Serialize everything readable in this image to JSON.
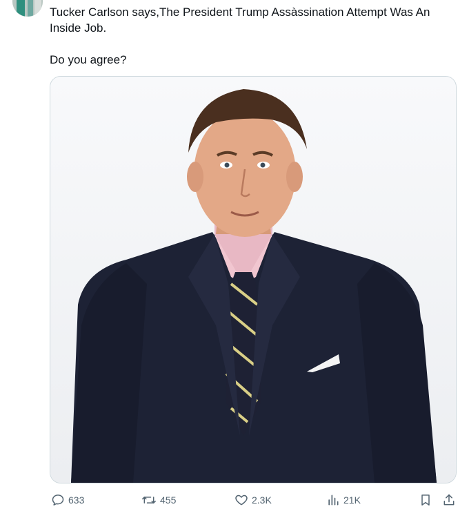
{
  "tweet": {
    "text_line1": "Tucker Carlson says,The President Trump Assàssination Attempt Was An Inside Job.",
    "text_line2": "Do you agree?"
  },
  "media": {
    "icon": "photo-of-man-in-navy-suit-and-striped-tie"
  },
  "actions": {
    "replies": "633",
    "retweets": "455",
    "likes": "2.3K",
    "views": "21K",
    "reply_icon": "reply-icon",
    "retweet_icon": "retweet-icon",
    "like_icon": "heart-icon",
    "views_icon": "analytics-icon",
    "bookmark_icon": "bookmark-icon",
    "share_icon": "share-icon"
  },
  "colors": {
    "text": "#0f1419",
    "muted": "#536471",
    "border": "#cfd9de"
  }
}
